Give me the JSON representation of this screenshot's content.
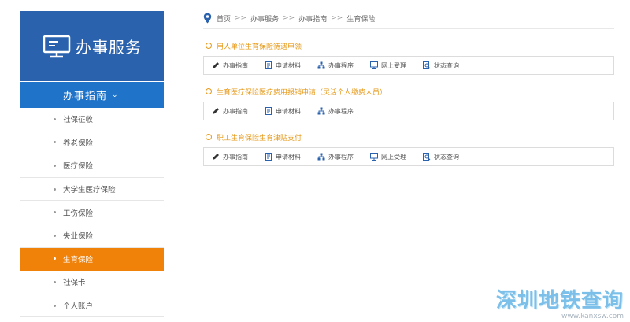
{
  "sidebar": {
    "brand_title": "办事服务",
    "section_title": "办事指南",
    "items": [
      {
        "label": "社保征收"
      },
      {
        "label": "养老保险"
      },
      {
        "label": "医疗保险"
      },
      {
        "label": "大学生医疗保险"
      },
      {
        "label": "工伤保险"
      },
      {
        "label": "失业保险"
      },
      {
        "label": "生育保险"
      },
      {
        "label": "社保卡"
      },
      {
        "label": "个人账户"
      }
    ]
  },
  "breadcrumb": [
    "首页",
    "办事服务",
    "办事指南",
    "生育保险"
  ],
  "breadcrumb_sep": ">>",
  "services": [
    {
      "title": "用人单位生育保险待遇申领",
      "actions": [
        "办事指南",
        "申请材料",
        "办事程序",
        "网上受理",
        "状态查询"
      ]
    },
    {
      "title": "生育医疗保险医疗费用报销申请（灵活个人缴费人员）",
      "actions": [
        "办事指南",
        "申请材料",
        "办事程序"
      ]
    },
    {
      "title": "职工生育保险生育津贴支付",
      "actions": [
        "办事指南",
        "申请材料",
        "办事程序",
        "网上受理",
        "状态查询"
      ]
    }
  ],
  "watermark": {
    "text": "深圳地铁查询",
    "url": "www.kanxsw.com"
  },
  "colors": {
    "brand_blue": "#2a62ad",
    "section_blue": "#1f73c8",
    "active_orange": "#f0820a",
    "service_title_orange": "#e69a1a"
  }
}
